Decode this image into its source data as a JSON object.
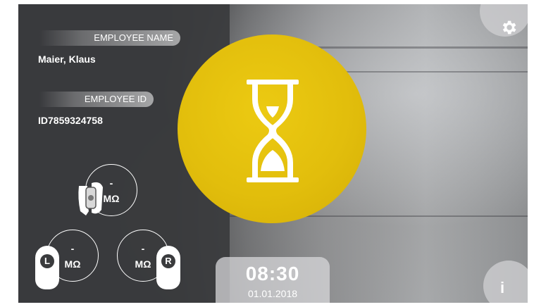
{
  "employee": {
    "name_label": "EMPLOYEE NAME",
    "name_value": "Maier, Klaus",
    "id_label": "EMPLOYEE ID",
    "id_value": "ID7859324758"
  },
  "measurements": {
    "wrist": {
      "value": "-",
      "unit": "MΩ",
      "icon": "wrist-strap-icon"
    },
    "left_foot": {
      "value": "-",
      "unit": "MΩ",
      "letter": "L",
      "icon": "left-shoe-icon"
    },
    "right_foot": {
      "value": "-",
      "unit": "MΩ",
      "letter": "R",
      "icon": "right-shoe-icon"
    }
  },
  "status": {
    "icon": "hourglass-icon",
    "color": "#e2be0c"
  },
  "clock": {
    "time": "08:30",
    "date": "01.01.2018"
  },
  "buttons": {
    "settings_icon": "gear-icon",
    "info_label": "i"
  }
}
